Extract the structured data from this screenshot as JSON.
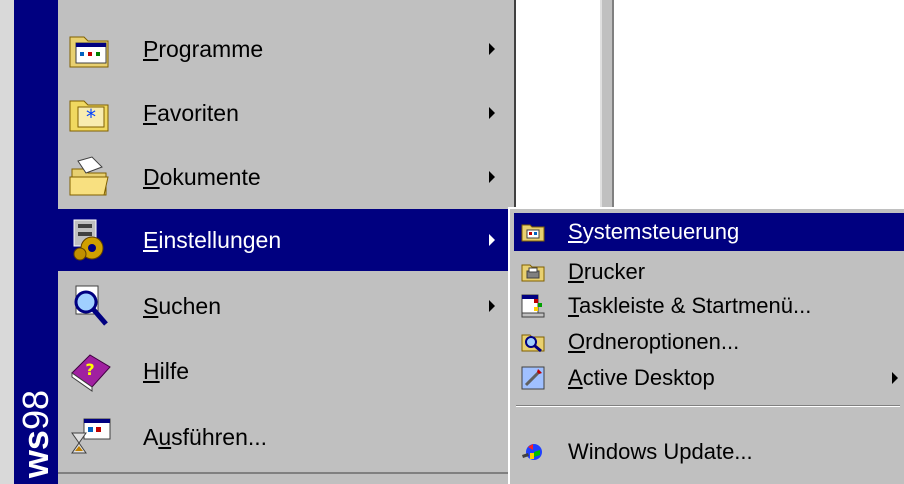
{
  "start_menu": {
    "banner": {
      "bold": "ws",
      "light": "98"
    },
    "items": [
      {
        "label_first": "P",
        "label_rest": "rogramme",
        "icon": "programs-folder-icon",
        "has_submenu": true
      },
      {
        "label_first": "F",
        "label_rest": "avoriten",
        "icon": "favorites-folder-icon",
        "has_submenu": true
      },
      {
        "label_first": "D",
        "label_rest": "okumente",
        "icon": "documents-folder-icon",
        "has_submenu": true
      },
      {
        "label_first": "E",
        "label_rest": "instellungen",
        "icon": "settings-icon",
        "has_submenu": true,
        "selected": true
      },
      {
        "label_first": "S",
        "label_rest": "uchen",
        "icon": "search-magnifier-icon",
        "has_submenu": true
      },
      {
        "label_first": "H",
        "label_rest": "ilfe",
        "icon": "help-book-icon",
        "has_submenu": false
      },
      {
        "label_pre": "A",
        "label_first": "u",
        "label_rest": "sführen...",
        "icon": "run-icon",
        "has_submenu": false
      }
    ]
  },
  "settings_submenu": {
    "items": [
      {
        "label_first": "S",
        "label_rest": "ystemsteuerung",
        "icon": "control-panel-folder-icon",
        "selected": true
      },
      {
        "label_first": "D",
        "label_rest": "rucker",
        "icon": "printers-folder-icon"
      },
      {
        "label_first": "T",
        "label_rest": "askleiste & Startmenü...",
        "icon": "taskbar-icon"
      },
      {
        "label_first": "O",
        "label_rest": "rdneroptionen...",
        "icon": "folder-options-icon"
      },
      {
        "label_first": "A",
        "label_rest": "ctive Desktop",
        "icon": "active-desktop-icon",
        "has_submenu": true
      },
      {
        "label": "Windows Update...",
        "icon": "windows-update-icon"
      }
    ]
  },
  "colors": {
    "menu_bg": "#c0c0c0",
    "highlight": "#000080",
    "banner": "#000080"
  }
}
